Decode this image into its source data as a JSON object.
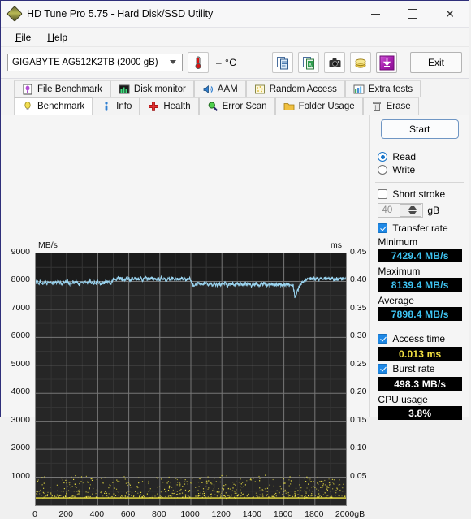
{
  "window": {
    "title": "HD Tune Pro 5.75 - Hard Disk/SSD Utility",
    "app_icon": "diamond-icon",
    "minimize": "minimize-icon",
    "maximize": "maximize-icon",
    "close": "close-icon"
  },
  "menu": [
    {
      "label": "File"
    },
    {
      "label": "Help"
    }
  ],
  "toolbar": {
    "drive": "GIGABYTE AG512K2TB (2000 gB)",
    "temperature": "– °C",
    "buttons": [
      {
        "name": "copy-icon",
        "title": "Copy"
      },
      {
        "name": "export-excel-icon",
        "title": "Export"
      },
      {
        "name": "camera-icon",
        "title": "Screenshot"
      },
      {
        "name": "coins-icon",
        "title": "Donate"
      },
      {
        "name": "download-icon",
        "title": "Download"
      }
    ],
    "exit_label": "Exit"
  },
  "tabs": {
    "row_top": [
      {
        "label": "File Benchmark",
        "icon": "file-benchmark-icon",
        "active": false
      },
      {
        "label": "Disk monitor",
        "icon": "disk-monitor-icon",
        "active": false
      },
      {
        "label": "AAM",
        "icon": "speaker-icon",
        "active": false
      },
      {
        "label": "Random Access",
        "icon": "random-access-icon",
        "active": false
      },
      {
        "label": "Extra tests",
        "icon": "extra-tests-icon",
        "active": false
      }
    ],
    "row_bottom": [
      {
        "label": "Benchmark",
        "icon": "bulb-icon",
        "active": true
      },
      {
        "label": "Info",
        "icon": "info-icon",
        "active": false
      },
      {
        "label": "Health",
        "icon": "health-cross-icon",
        "active": false
      },
      {
        "label": "Error Scan",
        "icon": "magnifier-icon",
        "active": false
      },
      {
        "label": "Folder Usage",
        "icon": "folder-icon",
        "active": false
      },
      {
        "label": "Erase",
        "icon": "trash-icon",
        "active": false
      }
    ]
  },
  "panel": {
    "start_label": "Start",
    "mode": {
      "read_label": "Read",
      "write_label": "Write",
      "selected": "Read"
    },
    "short_stroke": {
      "label": "Short stroke",
      "checked": false,
      "value": "40",
      "unit": "gB"
    },
    "transfer_rate": {
      "label": "Transfer rate",
      "checked": true,
      "minimum_label": "Minimum",
      "minimum_value": "7429.4 MB/s",
      "maximum_label": "Maximum",
      "maximum_value": "8139.4 MB/s",
      "average_label": "Average",
      "average_value": "7898.4 MB/s"
    },
    "access_time": {
      "label": "Access time",
      "checked": true,
      "value": "0.013 ms"
    },
    "burst_rate": {
      "label": "Burst rate",
      "checked": true,
      "value": "498.3 MB/s"
    },
    "cpu_usage": {
      "label": "CPU usage",
      "value": "3.8%"
    }
  },
  "colors": {
    "transfer_line": "#9ad4f0",
    "access_dot": "#f2e742",
    "plot_bg": "#1b1b1b",
    "grid": "#6e6e6e",
    "value_cyan": "#3fc4f2",
    "value_yellow": "#f4e242",
    "accent_blue": "#1673c8"
  },
  "chart_data": {
    "type": "line",
    "title": "",
    "ylabel": "MB/s",
    "y2label": "ms",
    "xlabel": "gB",
    "xlim": [
      0,
      2000
    ],
    "xticks": [
      "0",
      "200",
      "400",
      "600",
      "800",
      "1000",
      "1200",
      "1400",
      "1600",
      "1800",
      "2000gB"
    ],
    "ylim": [
      0,
      9000
    ],
    "yticks": [
      "1000",
      "2000",
      "3000",
      "4000",
      "5000",
      "6000",
      "7000",
      "8000",
      "9000"
    ],
    "y2lim": [
      0,
      0.45
    ],
    "y2ticks": [
      "0.05",
      "0.10",
      "0.15",
      "0.20",
      "0.25",
      "0.30",
      "0.35",
      "0.40",
      "0.45"
    ],
    "grid": true,
    "legend": "none",
    "series": [
      {
        "name": "Transfer rate",
        "axis": "left",
        "unit": "MB/s",
        "color": "#9ad4f0",
        "style": "line",
        "x": [
          0,
          10,
          20,
          30,
          40,
          50,
          60,
          70,
          80,
          90,
          100,
          110,
          120,
          130,
          140,
          150,
          160,
          170,
          180,
          190,
          200,
          210,
          220,
          230,
          240,
          250,
          260,
          270,
          280,
          290,
          300,
          310,
          320,
          330,
          340,
          350,
          360,
          370,
          380,
          390,
          400,
          410,
          420,
          430,
          440,
          450,
          460,
          470,
          480,
          490,
          500,
          510,
          520,
          530,
          540,
          550,
          560,
          570,
          580,
          590,
          600,
          610,
          620,
          630,
          640,
          650,
          660,
          670,
          680,
          690,
          700,
          710,
          720,
          730,
          740,
          750,
          760,
          770,
          780,
          790,
          800,
          810,
          820,
          830,
          840,
          850,
          860,
          870,
          880,
          890,
          900,
          910,
          920,
          930,
          940,
          950,
          960,
          970,
          980,
          990,
          1000,
          1010,
          1020,
          1030,
          1040,
          1050,
          1060,
          1070,
          1080,
          1090,
          1100,
          1110,
          1120,
          1130,
          1140,
          1150,
          1160,
          1170,
          1180,
          1190,
          1200,
          1210,
          1220,
          1230,
          1240,
          1250,
          1260,
          1270,
          1280,
          1290,
          1300,
          1310,
          1320,
          1330,
          1340,
          1350,
          1360,
          1370,
          1380,
          1390,
          1400,
          1410,
          1420,
          1430,
          1440,
          1450,
          1460,
          1470,
          1480,
          1490,
          1500,
          1510,
          1520,
          1530,
          1540,
          1550,
          1560,
          1570,
          1580,
          1590,
          1600,
          1610,
          1620,
          1630,
          1640,
          1650,
          1660,
          1670,
          1680,
          1690,
          1700,
          1710,
          1720,
          1730,
          1740,
          1750,
          1760,
          1770,
          1780,
          1790,
          1800,
          1810,
          1820,
          1830,
          1840,
          1850,
          1860,
          1870,
          1880,
          1890,
          1900,
          1910,
          1920,
          1930,
          1940,
          1950,
          1960,
          1970,
          1980,
          1990,
          2000
        ],
        "y": [
          7960,
          7990,
          7930,
          8010,
          7950,
          7900,
          7970,
          7930,
          8000,
          7940,
          7980,
          7920,
          7990,
          7950,
          8010,
          7930,
          7970,
          7900,
          7960,
          7940,
          8020,
          7960,
          7900,
          7950,
          7990,
          7930,
          8010,
          7950,
          7890,
          7960,
          8000,
          7930,
          7980,
          7920,
          7960,
          8010,
          7950,
          7900,
          7970,
          7930,
          8000,
          7950,
          7890,
          7960,
          7930,
          8010,
          7950,
          7980,
          7920,
          7960,
          8090,
          8120,
          8060,
          8110,
          8080,
          8130,
          8070,
          8100,
          8050,
          8120,
          8080,
          8040,
          8110,
          8060,
          8100,
          8070,
          8130,
          8080,
          8110,
          8050,
          8090,
          8120,
          8060,
          8100,
          8070,
          8120,
          8080,
          8110,
          8050,
          8090,
          8060,
          8120,
          8080,
          8100,
          8040,
          8090,
          8110,
          8060,
          8120,
          8080,
          8100,
          8050,
          8090,
          8060,
          8110,
          8070,
          8100,
          8040,
          8080,
          8120,
          8060,
          7890,
          7860,
          7920,
          7880,
          7940,
          7900,
          7870,
          7930,
          7890,
          7950,
          7900,
          7860,
          7920,
          7880,
          7940,
          7890,
          7860,
          7920,
          7880,
          7930,
          7890,
          7950,
          7900,
          7870,
          7920,
          7880,
          7940,
          7890,
          7860,
          7920,
          7880,
          7930,
          7900,
          7870,
          7920,
          7880,
          7940,
          7890,
          7860,
          7910,
          7880,
          7930,
          7890,
          7860,
          7920,
          7880,
          7930,
          7890,
          7860,
          7910,
          7870,
          7930,
          7880,
          7860,
          7910,
          7870,
          7920,
          7880,
          7850,
          7900,
          7870,
          7920,
          7880,
          7850,
          7900,
          7860,
          7430,
          7560,
          7700,
          7820,
          7900,
          7950,
          7990,
          8020,
          8060,
          8090,
          8110,
          8080,
          8120,
          8090,
          8130,
          8100,
          8060,
          8110,
          8080,
          8120,
          8090,
          8060,
          8110,
          8080,
          8130,
          8090,
          8060,
          8100,
          8070,
          8120,
          8080,
          8110,
          8050,
          8090,
          8120,
          8060,
          8100,
          8070,
          8130,
          8090,
          8120,
          8060
        ]
      },
      {
        "name": "Access time",
        "axis": "right",
        "unit": "ms",
        "color": "#f2e742",
        "style": "scatter",
        "mean": 0.013
      }
    ]
  }
}
